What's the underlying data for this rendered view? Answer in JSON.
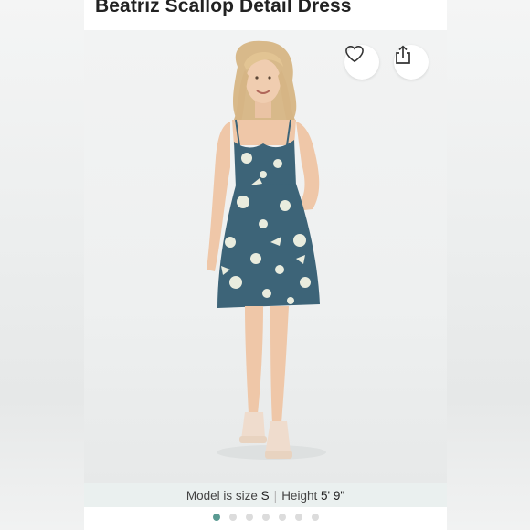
{
  "product": {
    "title": "Beatriz Scallop Detail Dress"
  },
  "actions": {
    "like_icon": "heart-icon",
    "share_icon": "share-icon"
  },
  "photo": {
    "description_icon": "product-photo"
  },
  "model_info": {
    "size_label": "Model is size",
    "size_value": "S",
    "separator": "|",
    "height_label": "Height",
    "height_value": "5' 9\""
  },
  "carousel": {
    "total": 7,
    "active_index": 0
  },
  "colors": {
    "accent": "#5a9a92",
    "dress": "#3d6478",
    "caption_bg": "#eaf0ef"
  }
}
